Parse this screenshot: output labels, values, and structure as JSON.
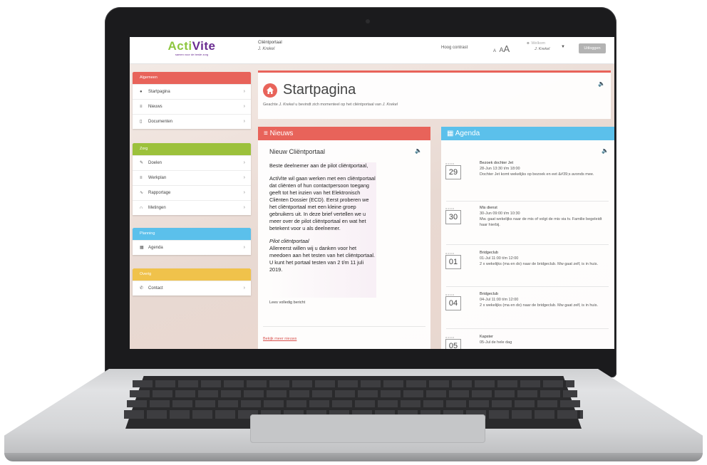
{
  "header": {
    "logo_main_a": "Acti",
    "logo_main_b": "Vite",
    "logo_sub": "samen voor de beste zorg",
    "portal_label": "Cliëntportaal",
    "portal_user": "J. Krekel",
    "high_contrast": "Hoog contrast",
    "font_small": "A",
    "font_mid": "A",
    "font_large": "A",
    "welcome_label": "Welkom",
    "welcome_user": "J. Krekel",
    "logout": "Uitloggen"
  },
  "sidebar": {
    "groups": [
      {
        "title": "Algemeen",
        "color": "#e8635a",
        "items": [
          {
            "label": "Startpagina",
            "icon": "home-icon"
          },
          {
            "label": "Nieuws",
            "icon": "list-icon"
          },
          {
            "label": "Documenten",
            "icon": "document-icon"
          }
        ]
      },
      {
        "title": "Zorg",
        "color": "#9cc13b",
        "items": [
          {
            "label": "Doelen",
            "icon": "pencil-icon"
          },
          {
            "label": "Werkplan",
            "icon": "list-icon"
          },
          {
            "label": "Rapportage",
            "icon": "chart-icon"
          },
          {
            "label": "Metingen",
            "icon": "measure-icon"
          }
        ]
      },
      {
        "title": "Planning",
        "color": "#5bc0eb",
        "items": [
          {
            "label": "Agenda",
            "icon": "calendar-icon"
          }
        ]
      },
      {
        "title": "Overig",
        "color": "#f0c24b",
        "items": [
          {
            "label": "Contact",
            "icon": "phone-icon"
          }
        ]
      }
    ]
  },
  "start": {
    "title": "Startpagina",
    "sub_prefix": "Geachte",
    "sub_user": "J. Krekel",
    "sub_middle": "u bevindt zich momenteel op het cliëntportaal van",
    "sub_user2": "J. Krekel"
  },
  "news": {
    "header": "Nieuws",
    "item_title": "Nieuw Cliëntportaal",
    "p1": "Beste deelnemer aan de pilot cliëntportaal,",
    "p2": "ActiVite wil gaan werken met een cliëntportaal dat cliënten of hun contactpersoon toegang geeft tot het inzien van het Elektronisch Cliënten Dossier (ECD). Eerst proberen we het cliëntportaal met een kleine groep gebruikers uit. In deze brief vertellen we u meer over de pilot cliëntportaal en wat het betekent voor u als deelnemer.",
    "p3_heading": "Pilot cliëntportaal",
    "p3": "Allereerst willen wij u danken voor het meedoen aan het testen van het cliëntportaal. U kunt het portaal testen van 2 t/m 11 juli 2019.",
    "read_more": "Lees volledig bericht",
    "more_news": "Bekijk meer nieuws"
  },
  "agenda": {
    "header": "Agenda",
    "items": [
      {
        "day": "29",
        "title": "Bezoek dochter Jet",
        "time": "28-Jun 13:30 t/m 18:00",
        "desc": "Dochter Jet komt wekelijks op bezoek en eet &#39;s avonds mee."
      },
      {
        "day": "30",
        "title": "Mis dienst",
        "time": "30-Jun 09:00 t/m 10:30",
        "desc": "Mw. gaat wekelijks naar de mis of volgt de mis via tv. Familie begeleidt haar hierbij."
      },
      {
        "day": "01",
        "title": "Bridgeclub",
        "time": "01-Jul 11:00 t/m 12:00",
        "desc": "2 x wekelijks (ma en do) naar de bridgeclub. Mw gaat zelf, is in huis."
      },
      {
        "day": "04",
        "title": "Bridgeclub",
        "time": "04-Jul 11:00 t/m 12:00",
        "desc": "2 x wekelijks (ma en do) naar de bridgeclub. Mw gaat zelf, is in huis."
      },
      {
        "day": "05",
        "title": "Kapster",
        "time": "05-Jul de hele dag",
        "desc": ""
      }
    ]
  }
}
